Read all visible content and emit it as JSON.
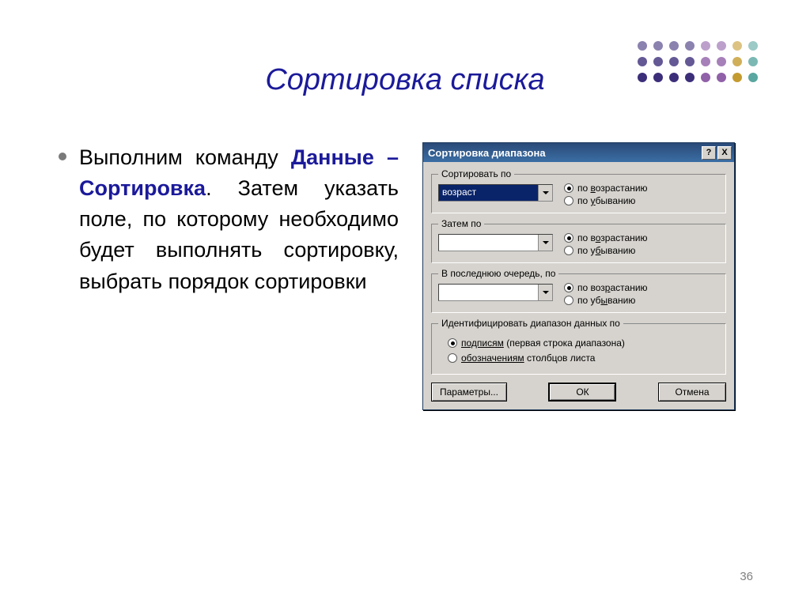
{
  "slide": {
    "title": "Сортировка списка",
    "page_number": "36",
    "bullet": {
      "pre": " Выполним команду ",
      "hl": "Данные – Сортировка",
      "post": ". Затем указать поле, по которому необходимо будет выполнять сортировку, выбрать порядок сортировки"
    }
  },
  "deco": {
    "colors": [
      "#3d2e7a",
      "#3d2e7a",
      "#3d2e7a",
      "#3d2e7a",
      "#9060a8",
      "#9060a8",
      "#c49b30",
      "#5aa6a0"
    ]
  },
  "dialog": {
    "title": "Сортировка диапазона",
    "help_btn": "?",
    "close_btn": "X",
    "group1": {
      "label": "Сортировать по",
      "value": "возраст",
      "r_asc": "по возрастанию",
      "r_desc": "по убыванию"
    },
    "group2": {
      "label": "Затем по",
      "value": "",
      "r_asc": "по возрастанию",
      "r_desc": "по убыванию"
    },
    "group3": {
      "label": "В последнюю очередь, по",
      "value": "",
      "r_asc": "по возрастанию",
      "r_desc": "по убыванию"
    },
    "ident": {
      "label": "Идентифицировать диапазон данных по",
      "r1_pre": "подписям",
      "r1_post": " (первая строка диапазона)",
      "r2_pre": "обозначениям",
      "r2_post": " столбцов листа"
    },
    "buttons": {
      "params": "Параметры...",
      "ok": "ОК",
      "cancel": "Отмена"
    }
  }
}
